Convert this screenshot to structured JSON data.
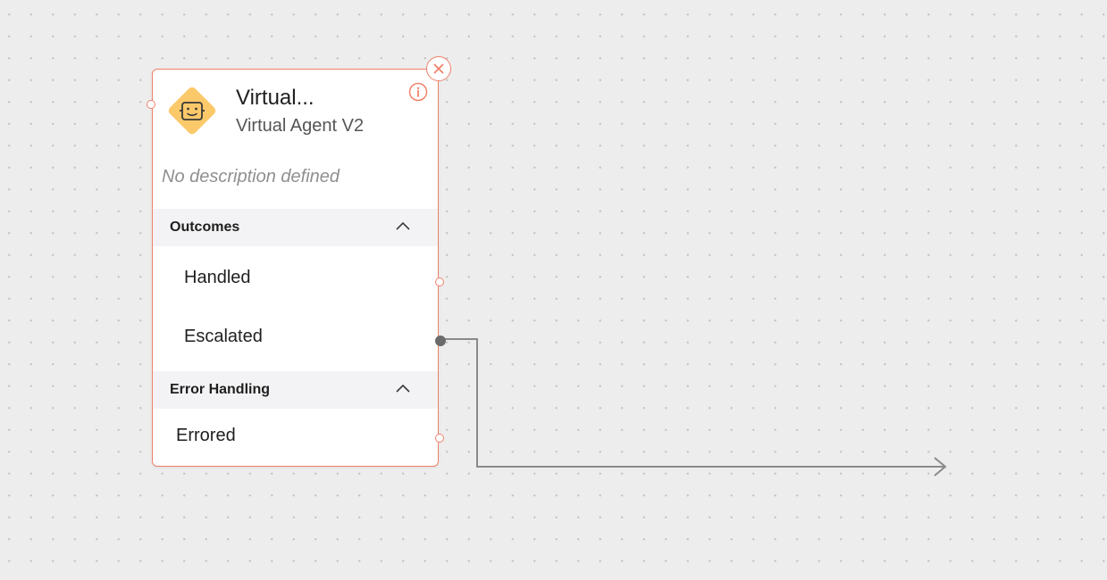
{
  "node": {
    "title": "Virtual...",
    "subtitle": "Virtual Agent V2",
    "description": "No description defined",
    "icon": "virtual-agent-bot-icon",
    "accent_color": "#f0826b",
    "icon_color": "#fcc96a",
    "sections": [
      {
        "label": "Outcomes",
        "expanded": true,
        "items": [
          "Handled",
          "Escalated"
        ]
      },
      {
        "label": "Error Handling",
        "expanded": true,
        "items": [
          "Errored"
        ]
      }
    ]
  },
  "connections": [
    {
      "from": "Escalated",
      "to": ""
    }
  ]
}
